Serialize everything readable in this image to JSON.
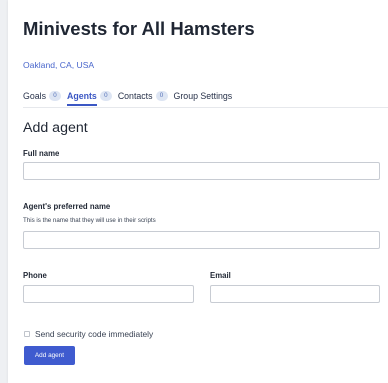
{
  "header": {
    "title": "Minivests for All Hamsters",
    "location": "Oakland, CA, USA"
  },
  "tabs": [
    {
      "label": "Goals",
      "count": "0",
      "active": false
    },
    {
      "label": "Agents",
      "count": "0",
      "active": true
    },
    {
      "label": "Contacts",
      "count": "0",
      "active": false
    },
    {
      "label": "Group Settings",
      "active": false
    }
  ],
  "form": {
    "title": "Add agent",
    "full_name": {
      "label": "Full name",
      "value": "",
      "placeholder": ""
    },
    "preferred_name": {
      "label": "Agent's preferred name",
      "hint": "This is the name that they will use in their scripts",
      "value": "",
      "placeholder": ""
    },
    "phone": {
      "label": "Phone",
      "value": "",
      "placeholder": ""
    },
    "email": {
      "label": "Email",
      "value": "",
      "placeholder": ""
    },
    "send_code": {
      "label": "Send security code immediately",
      "checked": false
    },
    "submit_label": "Add agent"
  },
  "colors": {
    "accent": "#3f5bcf",
    "link": "#4a67cc",
    "badge_bg": "#dde5f3"
  }
}
